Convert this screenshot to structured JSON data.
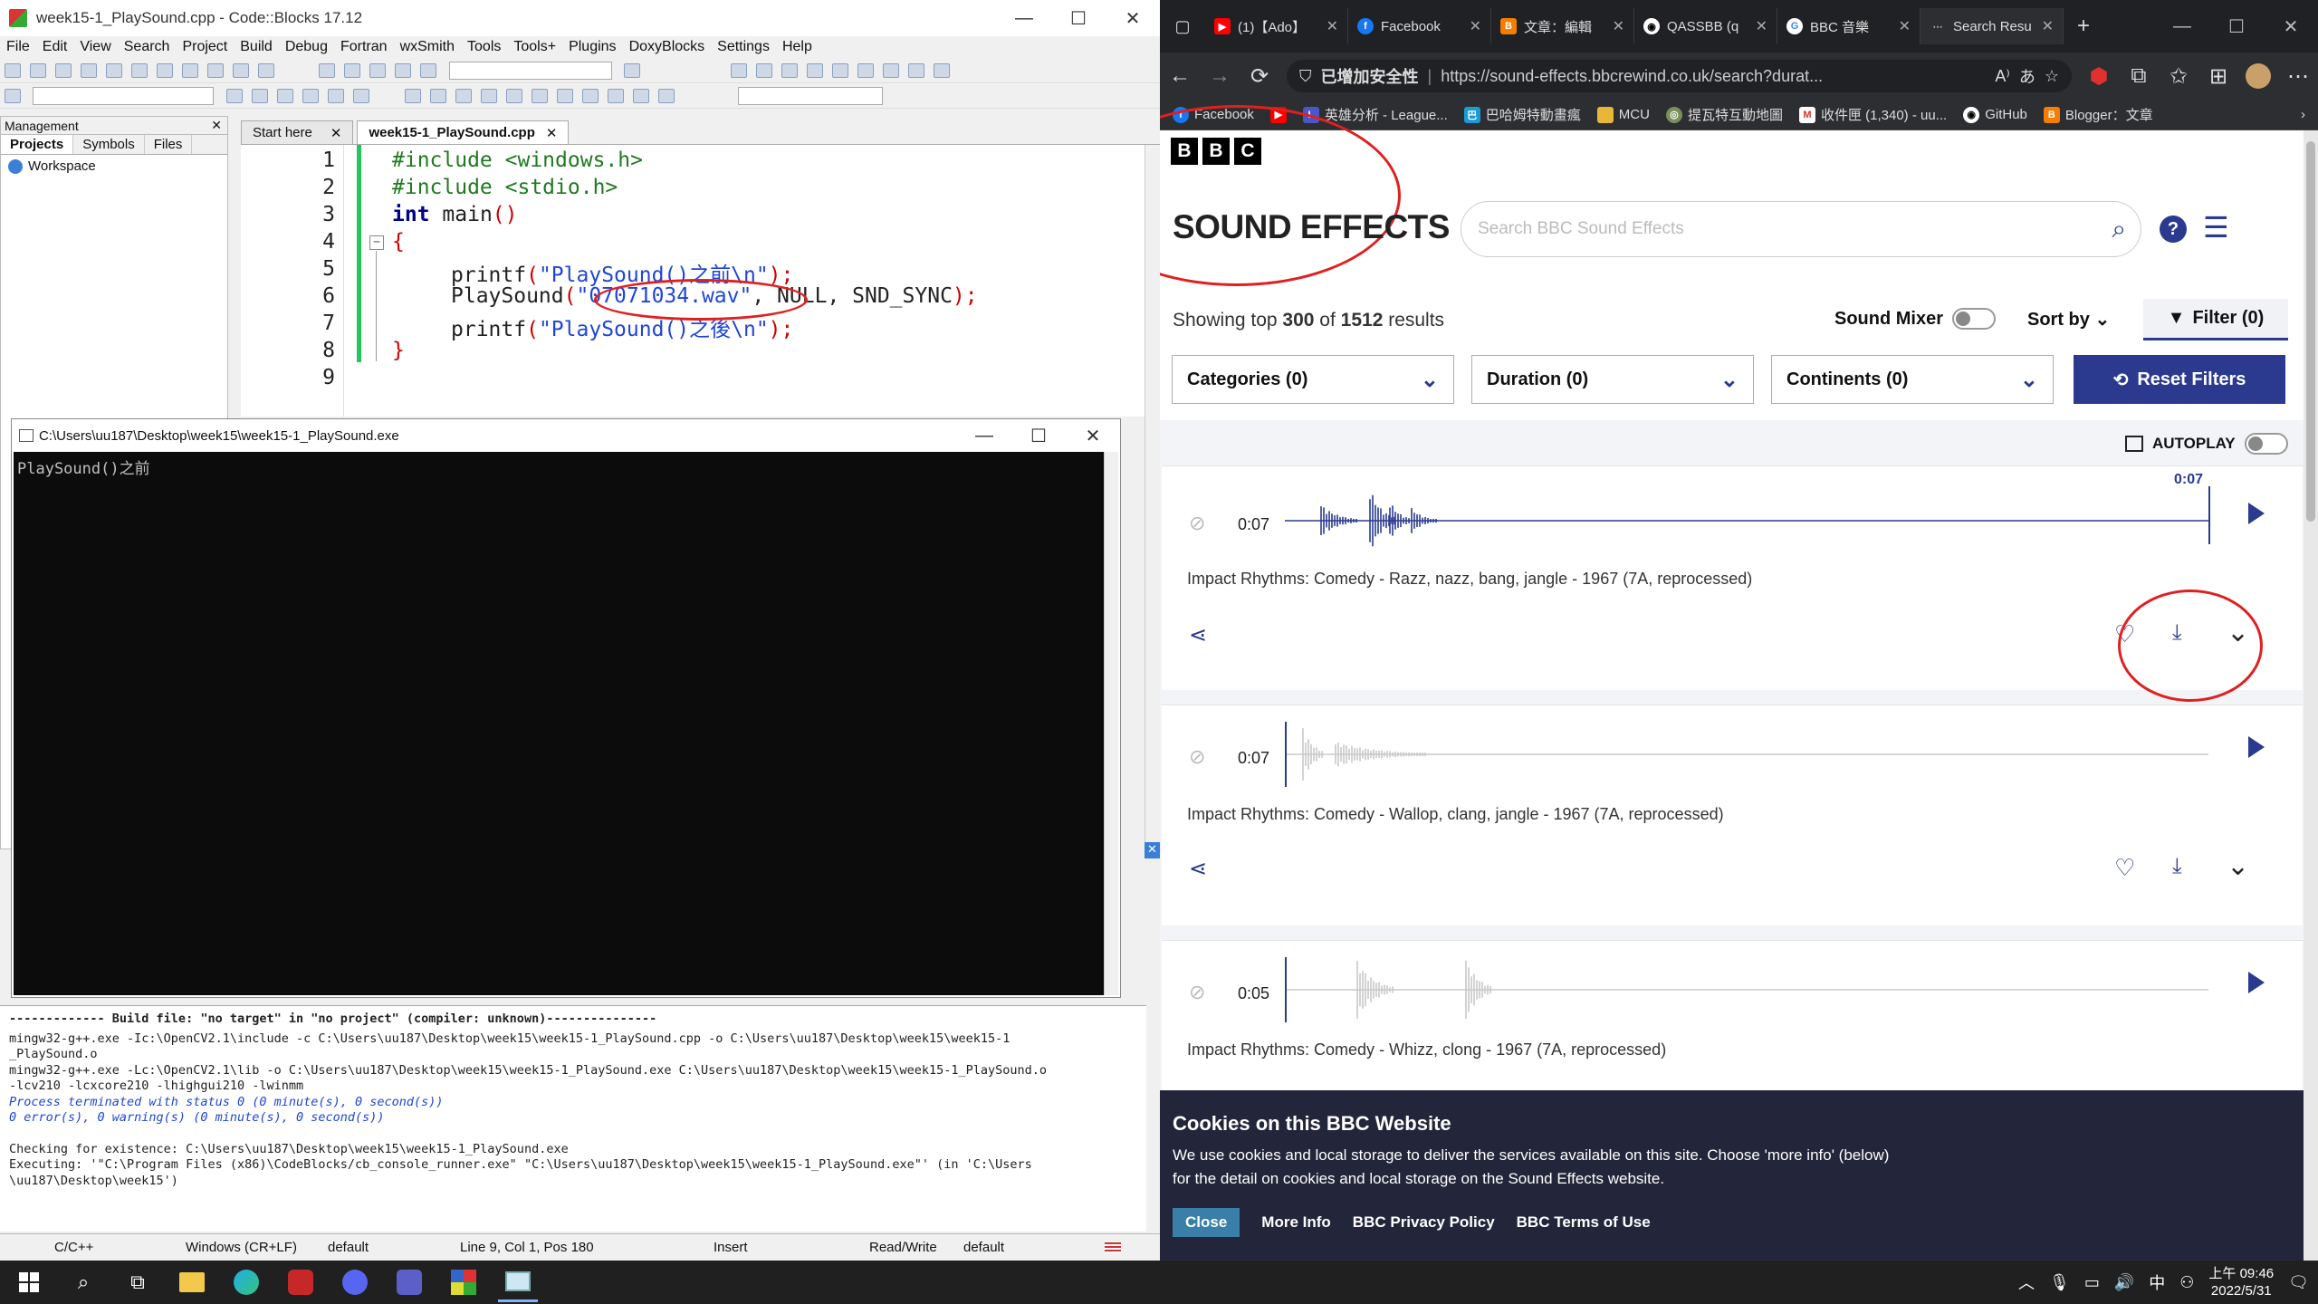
{
  "codeblocks": {
    "window_title": "week15-1_PlaySound.cpp - Code::Blocks 17.12",
    "menu": [
      "File",
      "Edit",
      "View",
      "Search",
      "Project",
      "Build",
      "Debug",
      "Fortran",
      "wxSmith",
      "Tools",
      "Tools+",
      "Plugins",
      "DoxyBlocks",
      "Settings",
      "Help"
    ],
    "management": {
      "title": "Management",
      "tabs": [
        "Projects",
        "Symbols",
        "Files"
      ],
      "tree_root": "Workspace"
    },
    "editor_tabs": [
      "Start here",
      "week15-1_PlaySound.cpp"
    ],
    "line_numbers": [
      "1",
      "2",
      "3",
      "4",
      "5",
      "6",
      "7",
      "8",
      "9"
    ],
    "code": {
      "l1_directive": "#include",
      "l1_header": "<windows.h>",
      "l2_directive": "#include",
      "l2_header": "<stdio.h>",
      "l3_type": "int",
      "l3_name": "main",
      "l3_parens": "()",
      "l4": "{",
      "l5_func": "printf",
      "l5_open": "(",
      "l5_str": "\"PlaySound()之前\\n\"",
      "l5_close": ");",
      "l6_func": "PlaySound",
      "l6_open": "(",
      "l6_str": "\"07071034.wav\"",
      "l6_rest": ", NULL, SND_SYNC",
      "l6_close": ");",
      "l7_func": "printf",
      "l7_open": "(",
      "l7_str": "\"PlaySound()之後\\n\"",
      "l7_close": ");",
      "l8": "}"
    },
    "console": {
      "title": "C:\\Users\\uu187\\Desktop\\week15\\week15-1_PlaySound.exe",
      "output": "PlaySound()之前"
    },
    "build_log": {
      "header": "------------- Build file: \"no target\" in \"no project\" (compiler: unknown)---------------",
      "lines": [
        "mingw32-g++.exe  -Ic:\\OpenCV2.1\\include -c C:\\Users\\uu187\\Desktop\\week15\\week15-1_PlaySound.cpp -o C:\\Users\\uu187\\Desktop\\week15\\week15-1",
        "_PlaySound.o",
        "mingw32-g++.exe -Lc:\\OpenCV2.1\\lib -o C:\\Users\\uu187\\Desktop\\week15\\week15-1_PlaySound.exe C:\\Users\\uu187\\Desktop\\week15\\week15-1_PlaySound.o",
        "-lcv210 -lcxcore210 -lhighgui210 -lwinmm"
      ],
      "status1": "Process terminated with status 0 (0 minute(s), 0 second(s))",
      "status2": "0 error(s), 0 warning(s) (0 minute(s), 0 second(s))",
      "checking": "Checking for existence: C:\\Users\\uu187\\Desktop\\week15\\week15-1_PlaySound.exe",
      "executing": "Executing: '\"C:\\Program Files (x86)\\CodeBlocks/cb_console_runner.exe\" \"C:\\Users\\uu187\\Desktop\\week15\\week15-1_PlaySound.exe\"' (in 'C:\\Users",
      "executing2": "\\uu187\\Desktop\\week15')"
    },
    "statusbar": {
      "lang": "C/C++",
      "eol": "Windows (CR+LF)",
      "enc": "default",
      "pos": "Line 9, Col 1, Pos 180",
      "mode": "Insert",
      "rw": "Read/Write",
      "extra": "default"
    }
  },
  "browser": {
    "tabs": [
      {
        "label": "(1)【Ado】",
        "icon": "youtube-icon"
      },
      {
        "label": "Facebook",
        "icon": "facebook-icon"
      },
      {
        "label": "文章：編輯",
        "icon": "blogger-icon"
      },
      {
        "label": "QASSBB (q",
        "icon": "github-icon"
      },
      {
        "label": "BBC 音樂",
        "icon": "google-icon"
      },
      {
        "label": "Search Resu",
        "icon": "loading-icon"
      }
    ],
    "secure_label": "已增加安全性",
    "url": "https://sound-effects.bbcrewind.co.uk/search?durat...",
    "bookmarks": [
      {
        "label": "Facebook",
        "icon": "facebook-icon"
      },
      {
        "label": "",
        "icon": "youtube-icon"
      },
      {
        "label": "英雄分析 - League...",
        "icon": "league-icon"
      },
      {
        "label": "巴哈姆特動畫瘋",
        "icon": "ani-icon"
      },
      {
        "label": "MCU",
        "icon": "folder-icon"
      },
      {
        "label": "提瓦特互動地圖",
        "icon": "map-icon"
      },
      {
        "label": "收件匣 (1,340) - uu...",
        "icon": "gmail-icon"
      },
      {
        "label": "GitHub",
        "icon": "github-icon"
      },
      {
        "label": "Blogger：文章",
        "icon": "blogger-icon"
      }
    ]
  },
  "bbc": {
    "logo": [
      "B",
      "B",
      "C"
    ],
    "title": "SOUND EFFECTS",
    "search_placeholder": "Search BBC Sound Effects",
    "results_prefix": "Showing top ",
    "results_top": "300",
    "results_mid": " of ",
    "results_total": "1512",
    "results_suffix": " results",
    "sound_mixer": "Sound Mixer",
    "sort_by": "Sort by",
    "filter": "Filter (0)",
    "filters": [
      "Categories (0)",
      "Duration (0)",
      "Continents (0)"
    ],
    "reset": "Reset Filters",
    "autoplay": "AUTOPLAY",
    "results": [
      {
        "duration": "0:07",
        "progress_label": "0:07",
        "title": "Impact Rhythms: Comedy - Razz, nazz, bang, jangle - 1967 (7A, reprocessed)",
        "played": true
      },
      {
        "duration": "0:07",
        "title": "Impact Rhythms: Comedy - Wallop, clang, jangle - 1967 (7A, reprocessed)",
        "played": false
      },
      {
        "duration": "0:05",
        "title": "Impact Rhythms: Comedy - Whizz, clong - 1967 (7A, reprocessed)",
        "played": false
      }
    ],
    "cookie": {
      "title": "Cookies on this BBC Website",
      "text1": "We use cookies and local storage to deliver the services available on this site. Choose 'more info' (below)",
      "text2": "for the detail on cookies and local storage on the Sound Effects website.",
      "buttons": [
        "Close",
        "More Info",
        "BBC Privacy Policy",
        "BBC Terms of Use"
      ]
    }
  },
  "taskbar": {
    "time": "上午 09:46",
    "date": "2022/5/31",
    "ime": "中"
  },
  "colors": {
    "bbc_navy": "#2b3a8f",
    "annotation_red": "#e02020",
    "wave_played": "#2b3a8f",
    "wave_unplayed": "#c8c8c8"
  }
}
